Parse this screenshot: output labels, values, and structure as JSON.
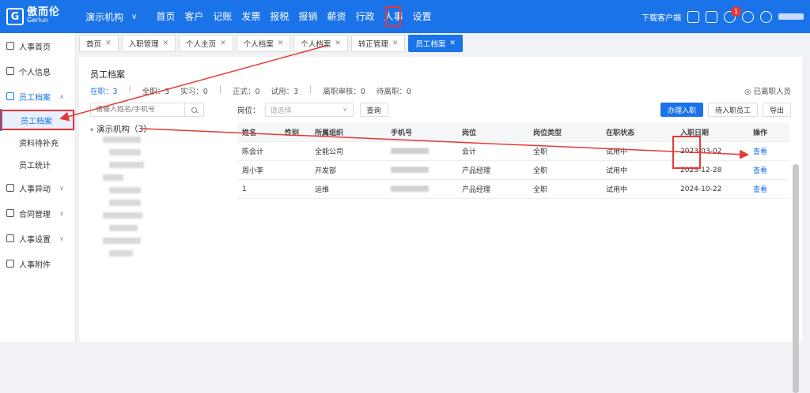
{
  "topbar": {
    "logo_cn": "傲而伦",
    "logo_en": "Gerlun",
    "org": "演示机构",
    "nav": [
      "首页",
      "客户",
      "记账",
      "发票",
      "报税",
      "报销",
      "薪资",
      "行政",
      "人事",
      "设置"
    ],
    "download": "下载客户端",
    "notification_count": "1"
  },
  "sidebar": {
    "items": [
      {
        "label": "人事首页",
        "icon": "home-icon"
      },
      {
        "label": "个人信息",
        "icon": "person-icon"
      },
      {
        "label": "员工档案",
        "icon": "archive-icon"
      },
      {
        "label": "人事异动",
        "icon": "transfer-icon"
      },
      {
        "label": "合同管理",
        "icon": "contract-icon"
      },
      {
        "label": "人事设置",
        "icon": "gear-icon"
      },
      {
        "label": "人事附件",
        "icon": "folder-icon"
      }
    ],
    "sub": [
      "员工档案",
      "资料待补充",
      "员工统计"
    ]
  },
  "tabs": [
    "首页",
    "入职管理",
    "个人主页",
    "个人档案",
    "个人档案",
    "转正管理",
    "员工档案"
  ],
  "main": {
    "title": "员工档案",
    "stats": [
      "在职：3",
      "全职：3",
      "实习：0",
      "正式：0",
      "试用：3",
      "离职审核：0",
      "待离职：0"
    ],
    "resigned": "已离职人员",
    "search_placeholder": "请输入姓名/手机号",
    "tree_root": "演示机构（3）",
    "post_label": "岗位：",
    "post_placeholder": "请选择",
    "query": "查询",
    "btn_onboard": "办理入职",
    "btn_pending": "待入职员工",
    "btn_export": "导出",
    "columns": [
      "姓名",
      "性别",
      "所属组织",
      "手机号",
      "岗位",
      "岗位类型",
      "在职状态",
      "入职日期",
      "操作"
    ],
    "rows": [
      {
        "name": "陈会计",
        "gender": "",
        "org": "全能公司",
        "post": "会计",
        "type": "全职",
        "status": "试用中",
        "date": "2023-03-02",
        "action": "查看"
      },
      {
        "name": "周小李",
        "gender": "",
        "org": "开发部",
        "post": "产品经理",
        "type": "全职",
        "status": "试用中",
        "date": "2023-12-28",
        "action": "查看"
      },
      {
        "name": "1",
        "gender": "",
        "org": "运维",
        "post": "产品经理",
        "type": "全职",
        "status": "试用中",
        "date": "2024-10-22",
        "action": "查看"
      }
    ]
  },
  "colors": {
    "primary": "#1a73e8",
    "highlight": "#e53935"
  }
}
